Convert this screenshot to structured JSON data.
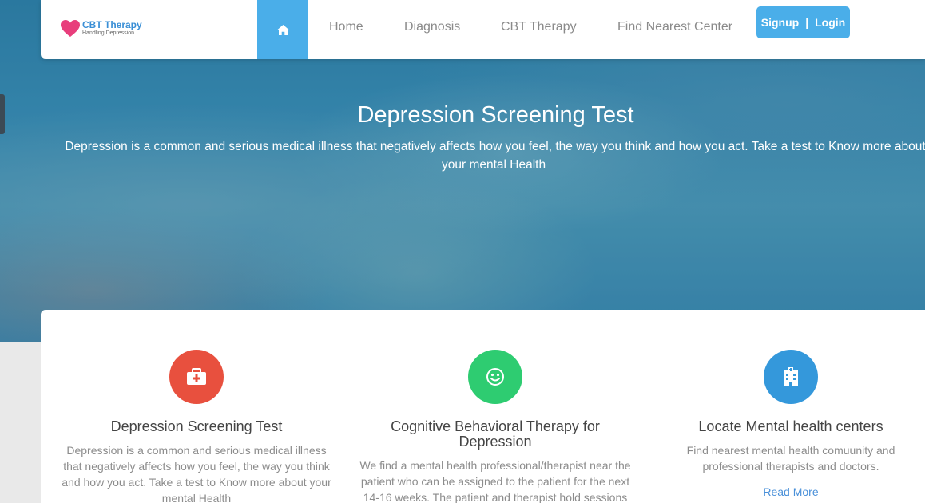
{
  "colors": {
    "accent": "#4aaee9",
    "red": "#e8503e",
    "green": "#2ecc71",
    "blue": "#3498db"
  },
  "logo": {
    "brand": "CBT Therapy",
    "tagline": "Handling Depression",
    "icon": "heart-icon"
  },
  "nav": {
    "home_icon": "home-icon",
    "items": [
      "Home",
      "Diagnosis",
      "CBT Therapy",
      "Find Nearest Center"
    ],
    "signup": "Signup",
    "separator": "|",
    "login": "Login"
  },
  "hero": {
    "title": "Depression Screening Test",
    "text_line1": "Depression is a common and serious medical illness that negatively affects how you feel, the way you think and how you act. Take a test to Know more about",
    "text_line2": "your mental Health"
  },
  "features": [
    {
      "icon": "medical-kit-icon",
      "title": "Depression Screening Test",
      "text": "Depression is a common and serious medical illness that negatively affects how you feel, the way you think and how you act. Take a test to Know more about your mental Health"
    },
    {
      "icon": "smiley-icon",
      "title": "Cognitive Behavioral Therapy for Depression",
      "text": "We find a mental health professional/therapist near the patient who can be assigned to the patient for the next 14-16 weeks. The patient and therapist hold sessions"
    },
    {
      "icon": "hospital-icon",
      "title": "Locate Mental health centers",
      "text": "Find nearest mental health comuunity and professional therapists and doctors.",
      "link": "Read More"
    }
  ]
}
